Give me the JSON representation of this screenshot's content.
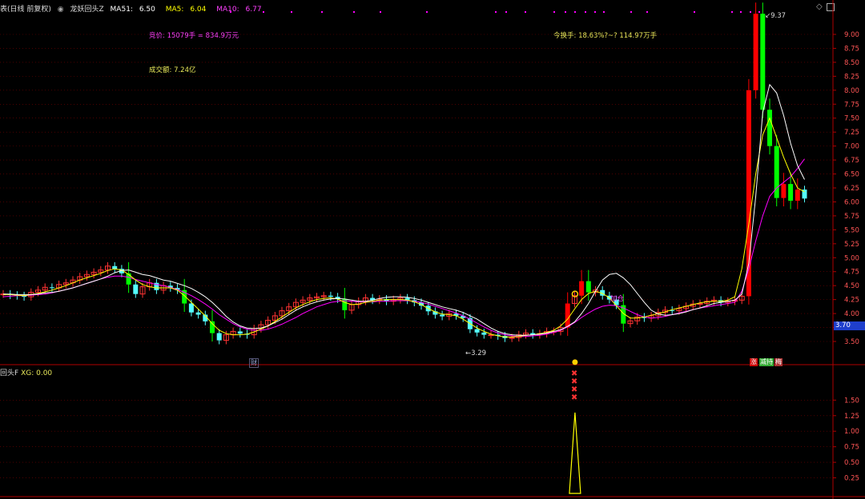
{
  "colors": {
    "up": "#ff3333",
    "down": "#54ffff",
    "bigdown": "#00ff00",
    "bigup": "#ff0000",
    "ma51": "#ffffff",
    "ma5": "#ffff00",
    "ma10": "#ff00ff",
    "grid": "#7a0000",
    "axis": "#b00000",
    "text_magenta": "#ff40ff",
    "text_yellow": "#e8e85a",
    "text_red": "#ff5555"
  },
  "header": {
    "period": "表(日线 前复权)",
    "indicator_name": "龙妖回头Z",
    "ma51_label": "MA51:",
    "ma51_value": "6.50",
    "ma5_label": "MA5:",
    "ma5_value": "6.04",
    "ma10_label": "MA10:",
    "ma10_value": "6.77"
  },
  "annotations": {
    "volume_text": "竞价: 15079手 = 834.9万元",
    "turnover_text": "今换手: 18.63%?~? 114.97万手",
    "amount_text": "成交额: 7.24亿",
    "high_marker": "9.37",
    "low_marker": "3.29",
    "cai_tag": "财",
    "tag_zhang": "涨",
    "tag_jianchi": "减持",
    "tag_mei": "梅",
    "pattern_label": "加仓"
  },
  "price_axis": {
    "ticks": [
      "9.00",
      "8.75",
      "8.50",
      "8.25",
      "8.00",
      "7.75",
      "7.50",
      "7.25",
      "7.00",
      "6.75",
      "6.50",
      "6.25",
      "6.00",
      "5.75",
      "5.50",
      "5.25",
      "5.00",
      "4.75",
      "4.50",
      "4.25",
      "4.00",
      "3.75",
      "3.50"
    ],
    "current_price": "3.70"
  },
  "sub_panel": {
    "title": "回头F",
    "xg_label": "XG:",
    "xg_value": "0.00",
    "ticks": [
      "1.50",
      "1.25",
      "1.00",
      "0.75",
      "0.50",
      "0.25"
    ]
  },
  "chart_data": {
    "type": "candlestick",
    "price_range": [
      3.3,
      9.4
    ],
    "closes": [
      4.35,
      4.33,
      4.32,
      4.3,
      4.38,
      4.42,
      4.47,
      4.46,
      4.52,
      4.55,
      4.6,
      4.66,
      4.7,
      4.74,
      4.78,
      4.85,
      4.8,
      4.72,
      4.52,
      4.35,
      4.48,
      4.55,
      4.42,
      4.5,
      4.46,
      4.42,
      4.18,
      4.02,
      3.98,
      3.86,
      3.65,
      3.52,
      3.62,
      3.68,
      3.64,
      3.62,
      3.73,
      3.8,
      3.88,
      3.96,
      4.05,
      4.12,
      4.2,
      4.24,
      4.28,
      4.3,
      4.32,
      4.3,
      4.26,
      4.06,
      4.16,
      4.22,
      4.28,
      4.24,
      4.26,
      4.22,
      4.25,
      4.28,
      4.24,
      4.2,
      4.14,
      4.04,
      3.98,
      3.95,
      4.0,
      3.96,
      3.92,
      3.72,
      3.66,
      3.62,
      3.62,
      3.6,
      3.56,
      3.57,
      3.62,
      3.65,
      3.62,
      3.64,
      3.68,
      3.68,
      3.75,
      4.18,
      4.32,
      4.58,
      4.38,
      4.42,
      4.32,
      4.25,
      4.15,
      3.82,
      3.87,
      3.94,
      3.92,
      3.96,
      4.02,
      4.06,
      4.05,
      4.09,
      4.13,
      4.17,
      4.18,
      4.22,
      4.24,
      4.2,
      4.22,
      4.24,
      4.31,
      8.0,
      9.37,
      7.65,
      7.0,
      6.07,
      6.32,
      6.02,
      6.22,
      6.06
    ],
    "ma51": [
      4.35,
      4.35,
      4.34,
      4.34,
      4.34,
      4.35,
      4.37,
      4.38,
      4.4,
      4.43,
      4.46,
      4.5,
      4.54,
      4.58,
      4.62,
      4.67,
      4.73,
      4.77,
      4.78,
      4.74,
      4.7,
      4.68,
      4.64,
      4.6,
      4.58,
      4.54,
      4.5,
      4.45,
      4.38,
      4.3,
      4.2,
      4.08,
      3.95,
      3.85,
      3.78,
      3.74,
      3.73,
      3.74,
      3.78,
      3.84,
      3.9,
      3.98,
      4.06,
      4.12,
      4.17,
      4.21,
      4.24,
      4.26,
      4.27,
      4.26,
      4.24,
      4.22,
      4.22,
      4.24,
      4.27,
      4.29,
      4.3,
      4.3,
      4.29,
      4.27,
      4.24,
      4.2,
      4.16,
      4.12,
      4.09,
      4.06,
      4.02,
      3.96,
      3.9,
      3.82,
      3.74,
      3.68,
      3.64,
      3.62,
      3.61,
      3.61,
      3.62,
      3.63,
      3.65,
      3.68,
      3.71,
      3.77,
      3.85,
      4.0,
      4.18,
      4.4,
      4.6,
      4.7,
      4.72,
      4.64,
      4.52,
      4.36,
      4.2,
      4.06,
      3.99,
      3.97,
      3.98,
      4.0,
      4.03,
      4.07,
      4.1,
      4.14,
      4.18,
      4.2,
      4.22,
      4.24,
      4.35,
      4.9,
      6.1,
      7.6,
      8.1,
      7.95,
      7.55,
      7.05,
      6.65,
      6.4
    ],
    "ma5": [
      4.34,
      4.34,
      4.33,
      4.32,
      4.34,
      4.36,
      4.39,
      4.42,
      4.46,
      4.5,
      4.55,
      4.6,
      4.64,
      4.68,
      4.72,
      4.77,
      4.8,
      4.78,
      4.7,
      4.6,
      4.52,
      4.48,
      4.46,
      4.46,
      4.46,
      4.42,
      4.32,
      4.2,
      4.08,
      3.96,
      3.82,
      3.7,
      3.64,
      3.62,
      3.62,
      3.63,
      3.67,
      3.72,
      3.78,
      3.86,
      3.94,
      4.02,
      4.1,
      4.16,
      4.21,
      4.25,
      4.27,
      4.28,
      4.26,
      4.2,
      4.16,
      4.17,
      4.2,
      4.22,
      4.24,
      4.25,
      4.25,
      4.25,
      4.24,
      4.21,
      4.16,
      4.09,
      4.03,
      3.99,
      3.98,
      3.96,
      3.9,
      3.82,
      3.74,
      3.68,
      3.63,
      3.6,
      3.58,
      3.58,
      3.59,
      3.61,
      3.62,
      3.64,
      3.66,
      3.7,
      3.78,
      3.9,
      4.08,
      4.25,
      4.36,
      4.4,
      4.36,
      4.28,
      4.14,
      4.0,
      3.92,
      3.92,
      3.94,
      3.97,
      4.0,
      4.03,
      4.07,
      4.1,
      4.13,
      4.16,
      4.19,
      4.21,
      4.22,
      4.22,
      4.24,
      4.3,
      4.8,
      5.6,
      6.5,
      7.2,
      7.5,
      7.15,
      6.8,
      6.5,
      6.25,
      6.18
    ],
    "ma10": [
      4.3,
      4.31,
      4.32,
      4.32,
      4.33,
      4.34,
      4.35,
      4.37,
      4.4,
      4.43,
      4.46,
      4.5,
      4.54,
      4.58,
      4.62,
      4.65,
      4.67,
      4.67,
      4.65,
      4.61,
      4.58,
      4.55,
      4.52,
      4.5,
      4.47,
      4.43,
      4.38,
      4.32,
      4.25,
      4.17,
      4.08,
      3.98,
      3.9,
      3.82,
      3.76,
      3.72,
      3.7,
      3.7,
      3.72,
      3.76,
      3.81,
      3.87,
      3.93,
      4.0,
      4.06,
      4.12,
      4.16,
      4.2,
      4.22,
      4.23,
      4.22,
      4.21,
      4.21,
      4.21,
      4.22,
      4.22,
      4.23,
      4.23,
      4.23,
      4.22,
      4.2,
      4.17,
      4.13,
      4.09,
      4.05,
      4.01,
      3.96,
      3.9,
      3.83,
      3.76,
      3.7,
      3.65,
      3.62,
      3.6,
      3.59,
      3.59,
      3.6,
      3.61,
      3.63,
      3.66,
      3.7,
      3.76,
      3.84,
      3.93,
      4.01,
      4.08,
      4.13,
      4.15,
      4.14,
      4.1,
      4.04,
      3.98,
      3.94,
      3.92,
      3.93,
      3.95,
      3.98,
      4.01,
      4.04,
      4.07,
      4.1,
      4.12,
      4.14,
      4.16,
      4.18,
      4.2,
      4.4,
      4.8,
      5.3,
      5.75,
      6.1,
      6.25,
      6.35,
      6.45,
      6.6,
      6.77
    ],
    "signal": {
      "bar_index": 82,
      "value": 1.3
    }
  }
}
